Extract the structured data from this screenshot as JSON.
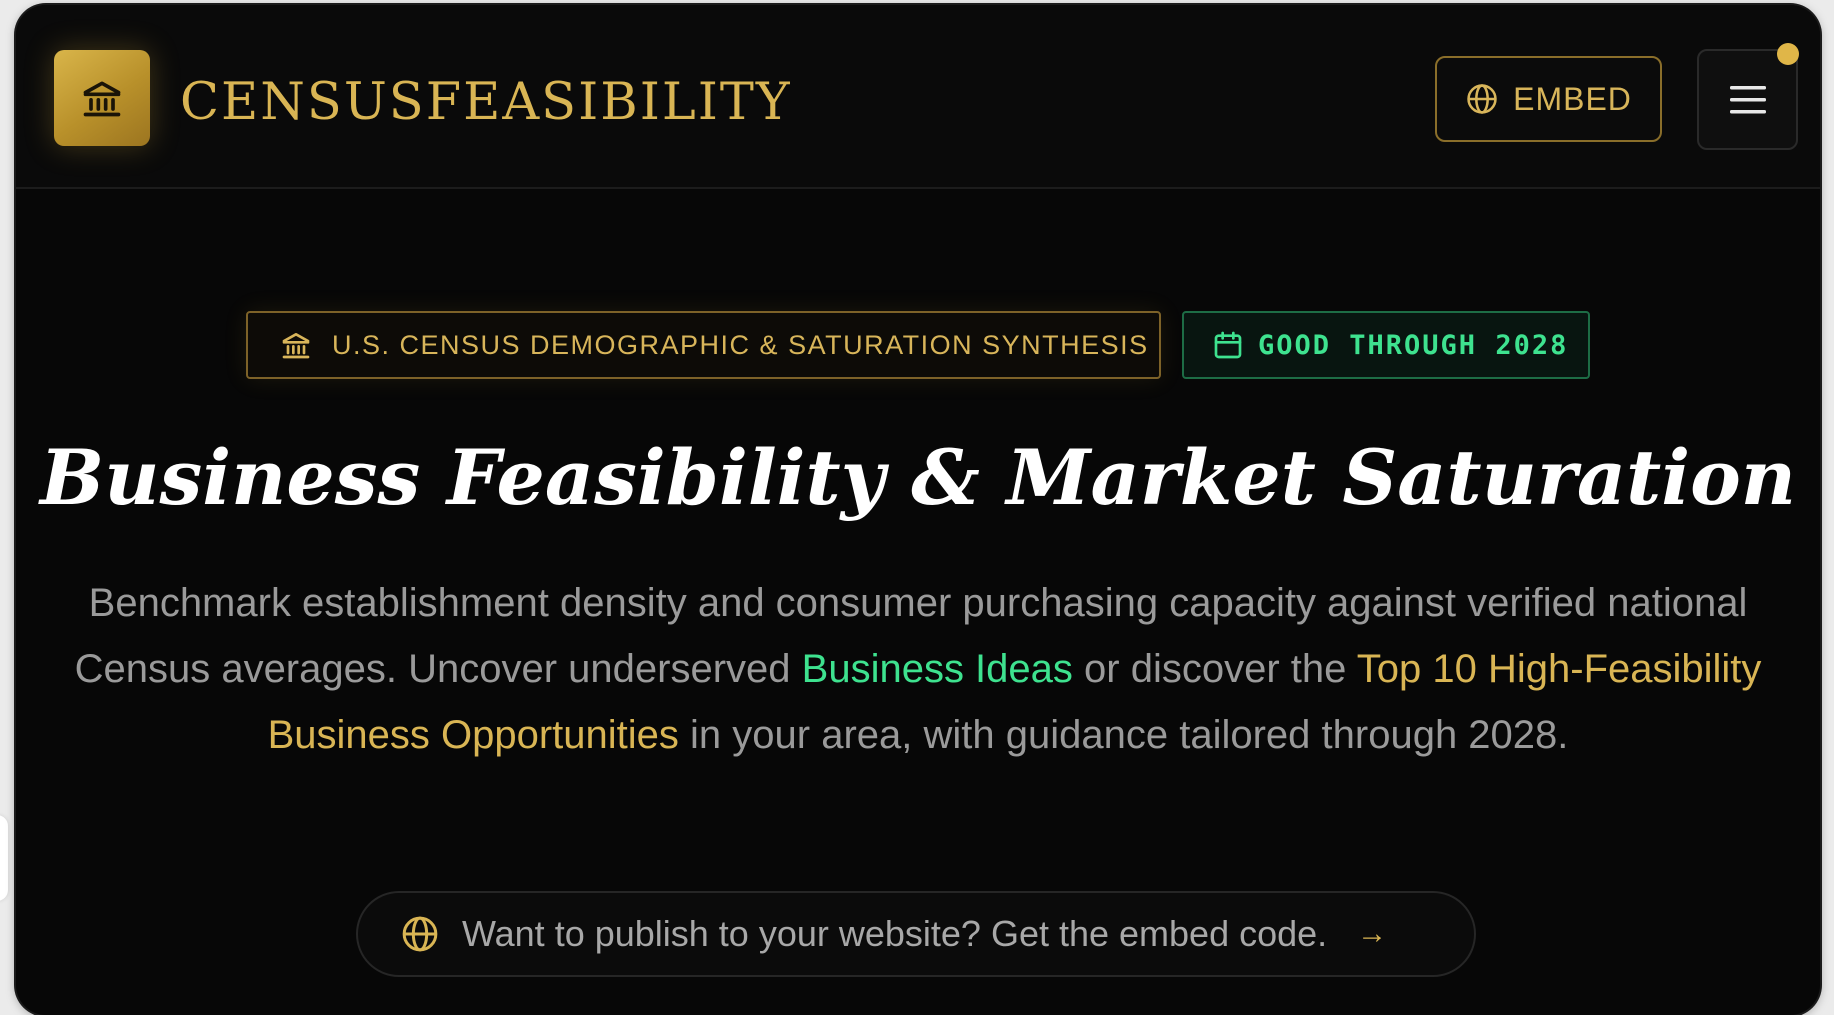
{
  "header": {
    "brand": "CENSUSFEASIBILITY",
    "embed_label": "EMBED",
    "logo_icon": "bank-icon",
    "menu_icon": "menu-icon",
    "notification_color": "#e0b648"
  },
  "hero": {
    "badge_census": "U.S. CENSUS DEMOGRAPHIC & SATURATION SYNTHESIS",
    "badge_good": "GOOD THROUGH 2028",
    "title": "Business Feasibility & Market Saturation",
    "lead": {
      "part1": "Benchmark establishment density and consumer purchasing capacity against verified national Census averages. Uncover underserved ",
      "link_ideas": "Business Ideas",
      "part2": " or discover the ",
      "link_top10": "Top 10 High-Feasibility Business Opportunities",
      "part3": " in your area, with guidance tailored through 2028."
    },
    "embed_pill": "Want to publish to your website? Get the embed code.",
    "embed_pill_arrow": "→"
  },
  "colors": {
    "gold": "#d9b554",
    "green": "#3ee28f",
    "background": "#070707"
  }
}
